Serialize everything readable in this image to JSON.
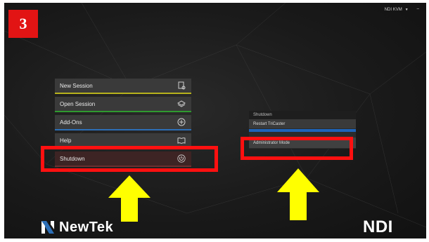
{
  "step": {
    "number": "3"
  },
  "header": {
    "kvm_label": "NDI KVM"
  },
  "menu": {
    "items": [
      {
        "label": "New Session",
        "icon": "new-document-icon",
        "accent": "#b7b21c"
      },
      {
        "label": "Open Session",
        "icon": "open-session-icon",
        "accent": "#2f9a2f"
      },
      {
        "label": "Add-Ons",
        "icon": "add-ons-icon",
        "accent": "#2c6fb7"
      },
      {
        "label": "Help",
        "icon": "book-icon",
        "accent": "#6a3a9a"
      },
      {
        "label": "Shutdown",
        "icon": "power-icon",
        "accent": "#6a3030"
      }
    ]
  },
  "shutdown_panel": {
    "title": "Shutdown",
    "items": [
      {
        "label": "Restart TriCaster"
      },
      {
        "label": "Administrator Mode"
      }
    ]
  },
  "brand": {
    "newtek": "NewTek",
    "ndi": "NDI"
  },
  "colors": {
    "highlight": "#ff1010",
    "arrow": "#ffff00",
    "badge": "#e21414"
  }
}
